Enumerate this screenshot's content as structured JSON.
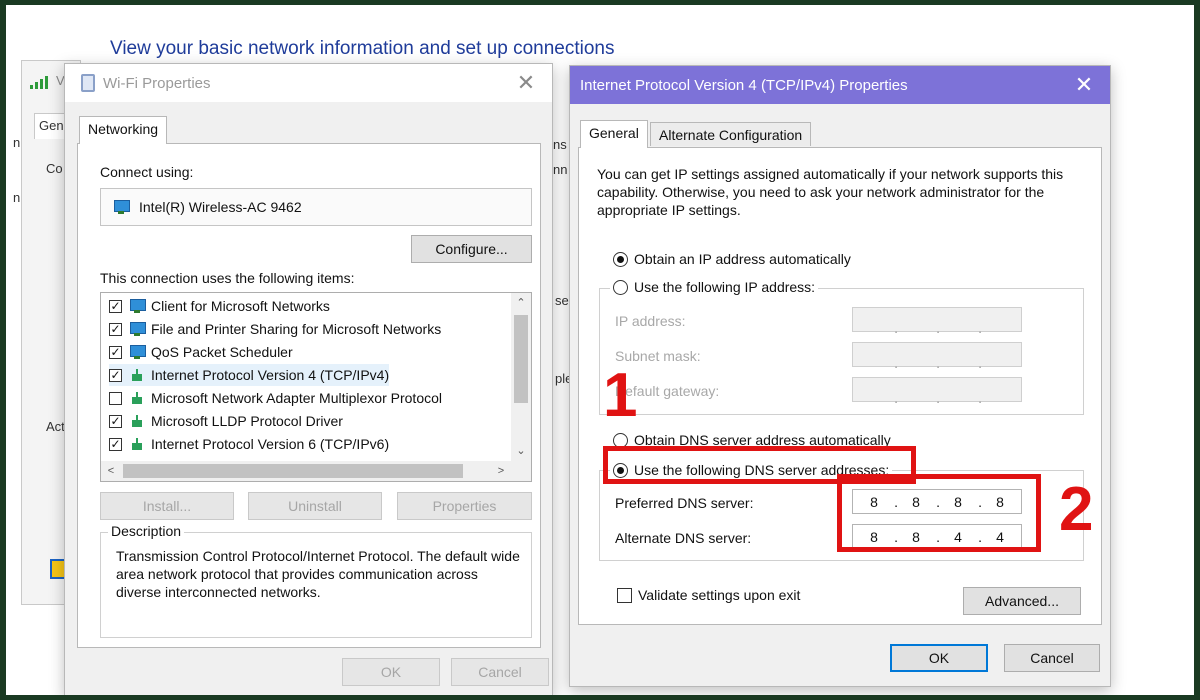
{
  "background": {
    "heading": "View your basic network information and set up connections",
    "fragments": {
      "gen": "Gene",
      "con": "Co",
      "act": "Act",
      "ns": "ns",
      "nn": "nn",
      "se": "se",
      "ple": "ple",
      "wv": "V",
      "n1": "n",
      "n2": "n"
    }
  },
  "wifi_dialog": {
    "title": "Wi-Fi Properties",
    "close": "✕",
    "tab": "Networking",
    "connect_using_label": "Connect using:",
    "adapter": "Intel(R) Wireless-AC 9462",
    "configure_btn": "Configure...",
    "items_label": "This connection uses the following items:",
    "items": [
      {
        "label": "Client for Microsoft Networks",
        "checked": true,
        "mark": "✓",
        "icon": "computer-network-icon"
      },
      {
        "label": "File and Printer Sharing for Microsoft Networks",
        "checked": true,
        "mark": "✓",
        "icon": "computer-network-icon"
      },
      {
        "label": "QoS Packet Scheduler",
        "checked": true,
        "mark": "✓",
        "icon": "computer-network-icon"
      },
      {
        "label": "Internet Protocol Version 4 (TCP/IPv4)",
        "checked": true,
        "mark": "✓",
        "icon": "protocol-icon"
      },
      {
        "label": "Microsoft Network Adapter Multiplexor Protocol",
        "checked": false,
        "mark": "",
        "icon": "protocol-icon"
      },
      {
        "label": "Microsoft LLDP Protocol Driver",
        "checked": true,
        "mark": "✓",
        "icon": "protocol-icon"
      },
      {
        "label": "Internet Protocol Version 6 (TCP/IPv6)",
        "checked": true,
        "mark": "✓",
        "icon": "protocol-icon"
      }
    ],
    "scroll_up": "⌃",
    "scroll_down": "⌄",
    "scroll_left": "<",
    "scroll_right": ">",
    "install_btn": "Install...",
    "uninstall_btn": "Uninstall",
    "properties_btn": "Properties",
    "description_label": "Description",
    "description_text": "Transmission Control Protocol/Internet Protocol. The default wide area network protocol that provides communication across diverse interconnected networks.",
    "ok_btn": "OK",
    "cancel_btn": "Cancel"
  },
  "ipv4_dialog": {
    "title": "Internet Protocol Version 4 (TCP/IPv4) Properties",
    "close": "✕",
    "tabs": [
      "General",
      "Alternate Configuration"
    ],
    "info_text": "You can get IP settings assigned automatically if your network supports this capability. Otherwise, you need to ask your network administrator for the appropriate IP settings.",
    "ip_auto": "Obtain an IP address automatically",
    "ip_manual": "Use the following IP address:",
    "ip_address_label": "IP address:",
    "subnet_label": "Subnet mask:",
    "gateway_label": "Default gateway:",
    "dns_auto": "Obtain DNS server address automatically",
    "dns_manual": "Use the following DNS server addresses:",
    "preferred_label": "Preferred DNS server:",
    "alternate_label": "Alternate DNS server:",
    "preferred_dns": [
      "8",
      "8",
      "8",
      "8"
    ],
    "alternate_dns": [
      "8",
      "8",
      "4",
      "4"
    ],
    "dot": ".",
    "validate_label": "Validate settings upon exit",
    "advanced_btn": "Advanced...",
    "ok_btn": "OK",
    "cancel_btn": "Cancel"
  },
  "annotations": {
    "step1": "1",
    "step2": "2",
    "color": "#e01313"
  }
}
